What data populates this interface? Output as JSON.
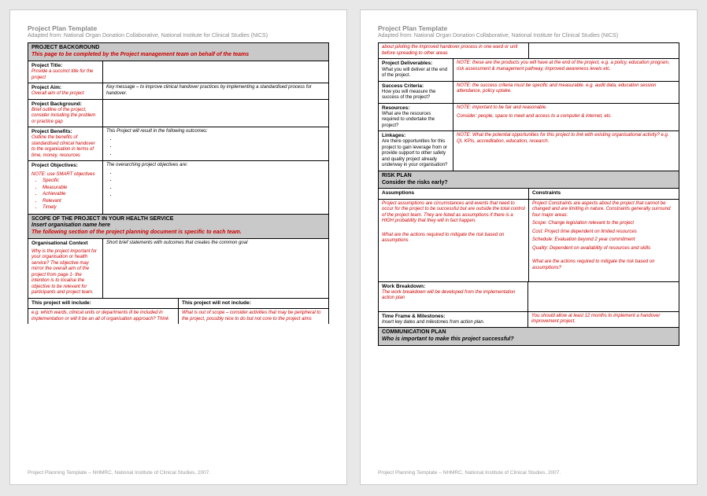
{
  "header": {
    "title": "Project Plan Template",
    "subtitle": "Adapted from: National Organ Donation Collaborative, National Institute for Clinical Studies (NICS)"
  },
  "footer": "Project Planning Template – NHMRC, National Institute of Clinical Studies, 2007.",
  "p1": {
    "sec_bg": {
      "title": "PROJECT BACKGROUND",
      "sub": "This page to be completed by the Project management team on behalf of the teams"
    },
    "title_row": {
      "label": "Project Title:",
      "note": "Provide a succinct title for the project"
    },
    "aim_row": {
      "label": "Project Aim:",
      "sub": "Overall aim of the project",
      "content": "Key message – to improve clinical handover practices by implementing a standardised process for handover."
    },
    "bg_row": {
      "label": "Project Background:",
      "note": "Brief outline of the project, consider including the problem or practice gap"
    },
    "benefits_row": {
      "label": "Project Benefits:",
      "note": "Outline the benefits of standardised clinical handover to the organisation in terms of time, money, resources",
      "content": "This Project will result in the following outcomes:"
    },
    "objectives_row": {
      "label": "Project Objectives:",
      "note": "NOTE: use SMART objectives",
      "bullets": [
        "Specific",
        "Measurable",
        "Achievable",
        "Relevant",
        "Timely"
      ],
      "content": "The overarching project objectives are:"
    },
    "sec_scope": {
      "title": "SCOPE OF THE PROJECT IN YOUR HEALTH SERVICE",
      "sub1": "Insert organisation name here",
      "sub2": "The following section of the project planning document is specific to each team."
    },
    "org_row": {
      "label": "Organisational Context",
      "note": "Why is the project important for your organisation or health service? The objective may mirror the overall aim of the project from page 1- the intention is to localise the objective to be relevant for participants and project team.",
      "content": "Short brief statements with outcomes that creates the common goal"
    },
    "include_head": {
      "left": "This project will include:",
      "right": "This project will not include:"
    },
    "include_body": {
      "left": "e.g. which wards, clinical units or departments ill be included in implementation or will it be an all of organisation approach? Think",
      "right": "What is out of scope – consider activities that may be peripheral to the project, possibly nice to do but not core to the project aims"
    }
  },
  "p2": {
    "pilot_note": "about piloting the improved handover process in one ward or unit before spreading to other areas",
    "deliv_row": {
      "label": "Project Deliverables:",
      "sub": "What you will deliver at the end of the project.",
      "note": "NOTE: these are the products you will have at the end of the project, e.g. a policy, education program, risk assessment & management pathway, improved awareness levels etc."
    },
    "success_row": {
      "label": "Success Criteria:",
      "sub": "How you will measure the success of the project?",
      "note": "NOTE: the success criteria must be specific and measurable. e.g. audit data, education session attendance, policy uptake."
    },
    "resources_row": {
      "label": "Resources:",
      "sub": "What are the resources required to undertake the project?",
      "note1": "NOTE: important to be fair and reasonable.",
      "note2": "Consider: people, space to meet and access to a computer & internet, etc."
    },
    "link_row": {
      "label": "Linkages:",
      "sub": "Are there opportunities for this project to gain leverage from or provide support to other safety and quality project already underway in your organisation?",
      "note": "NOTE: What the potential opportunities for this project to link with existing organisational activity?  e.g. QI, KPIs,  accreditation, education, research."
    },
    "sec_risk": {
      "title": "RISK PLAN",
      "sub": "Consider the risks early?"
    },
    "ac_head": {
      "left": "Assumptions",
      "right": "Constraints"
    },
    "ac_body": {
      "left1": "Project assumptions are circumstances and events that need to occur for the project to be successful but are outside the total control of the project team. They are listed as assumptions if there is a HIGH probability that they will in fact happen.",
      "left2": "What are the actions required to mitigate the risk based on assumptions",
      "right1": "Project Constraints are aspects about the project that cannot be changed and are limiting in nature. Constraints generally surround four major areas:",
      "r_scope": "Scope: Change legislation relevant to the project",
      "r_cost": "Cost: Project time dependent on limited resources",
      "r_sched": "Schedule: Evaluation beyond 2 year commitment",
      "r_qual": "Quality: Dependent on availability of resources and skills",
      "right2": "What are the actions required to mitigate the risk based on assumptions?"
    },
    "wb_row": {
      "label": "Work Breakdown:",
      "note": "The work breakdown will be developed from the implementation action plan"
    },
    "tf_row": {
      "label": "Time Frame & Milestones:",
      "sub": "Insert key dates and milestones from action plan.",
      "note": "You should allow at least 12 months to implement a handover improvement project."
    },
    "sec_comm": {
      "title": "COMMUNICATION PLAN",
      "sub": "Who is important to make this project successful?"
    }
  }
}
